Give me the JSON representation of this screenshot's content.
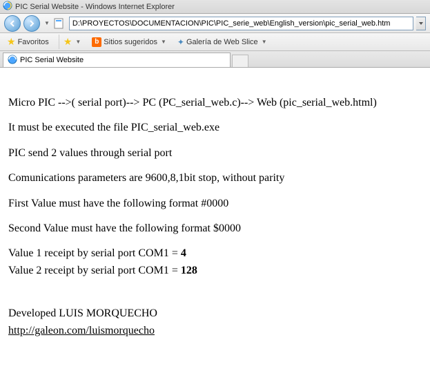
{
  "window": {
    "title": "PIC Serial Website - Windows Internet Explorer"
  },
  "address_bar": {
    "url": "D:\\PROYECTOS\\DOCUMENTACION\\PIC\\PIC_serie_web\\English_version\\pic_serial_web.htm"
  },
  "favorites_bar": {
    "label": "Favoritos",
    "items": [
      {
        "label": "Sitios sugeridos"
      },
      {
        "label": "Galería de Web Slice"
      }
    ]
  },
  "tab": {
    "title": "PIC Serial Website"
  },
  "content": {
    "line1": "Micro PIC -->( serial port)--> PC (PC_serial_web.c)--> Web (pic_serial_web.html)",
    "line2": "It must be executed the file PIC_serial_web.exe",
    "line3": "PIC send 2 values through serial port",
    "line4": "Comunications parameters are 9600,8,1bit stop, without parity",
    "line5": "First Value must have the following format #0000",
    "line6": "Second Value must have the following format $0000",
    "value1_label": "Value 1 receipt by serial port COM1 = ",
    "value1": "4",
    "value2_label": "Value 2 receipt by serial port COM1 = ",
    "value2": "128",
    "developed": "Developed LUIS MORQUECHO",
    "url": "http://galeon.com/luismorquecho"
  }
}
